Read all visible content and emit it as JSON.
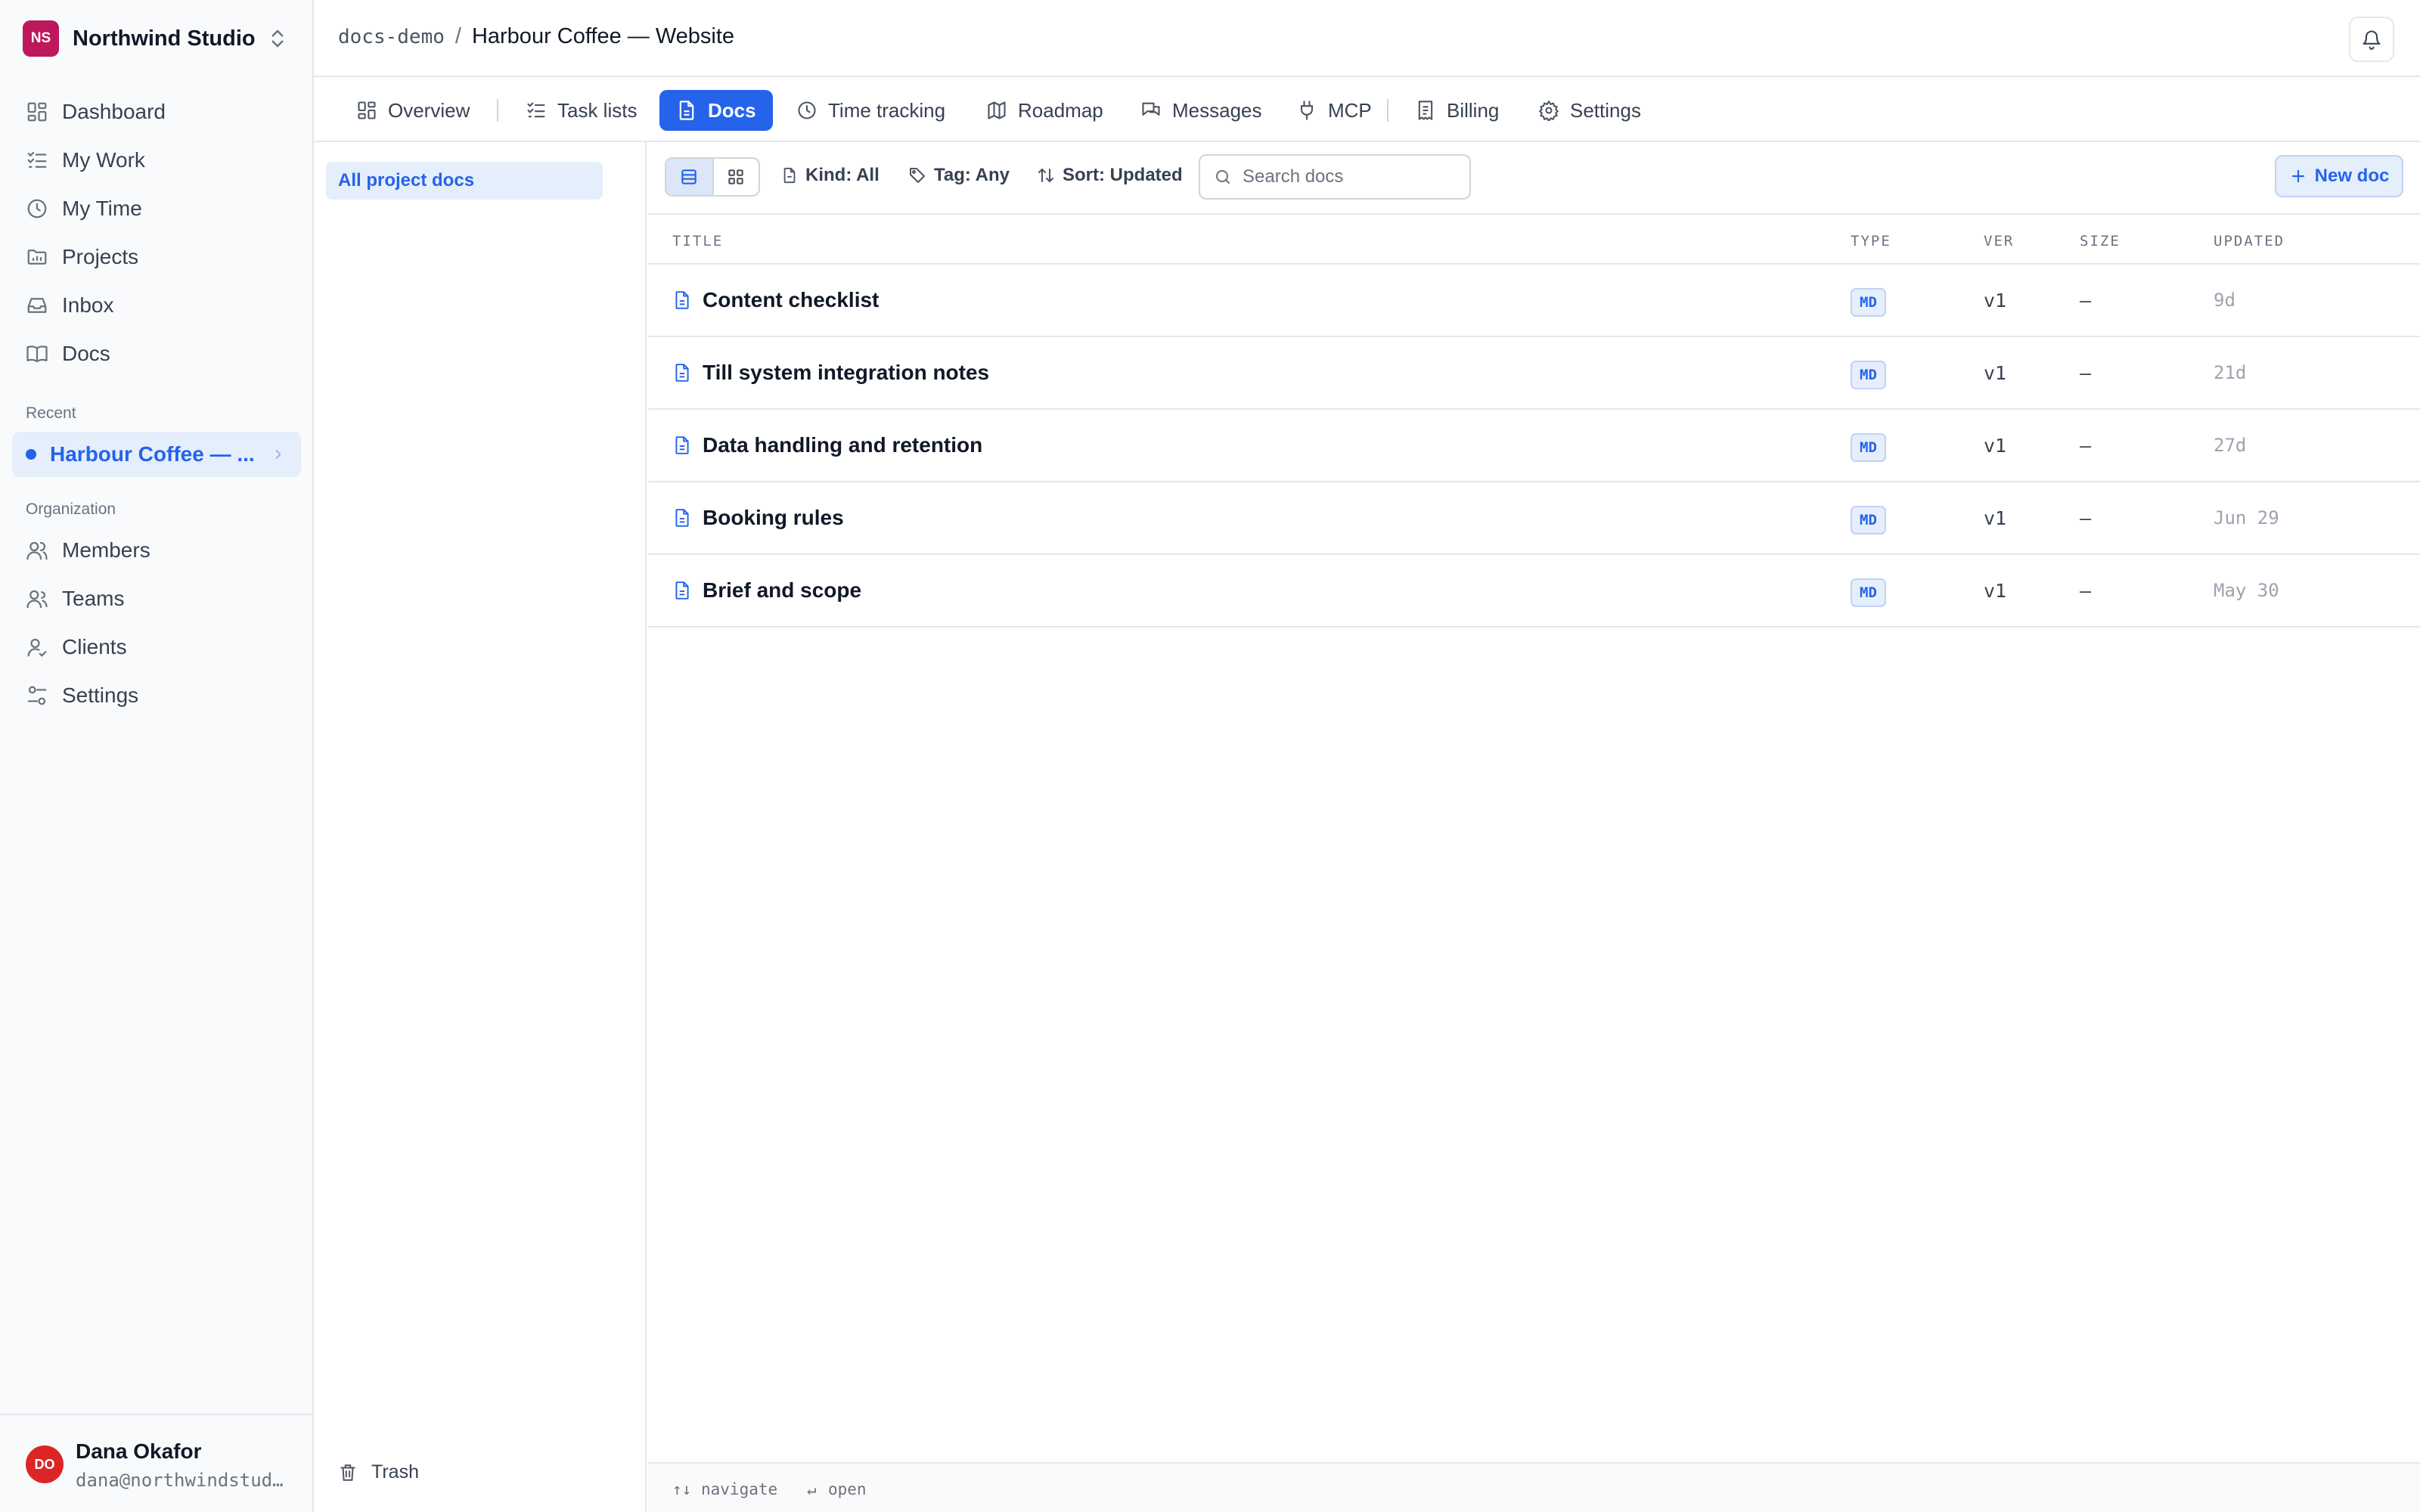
{
  "org": {
    "initials": "NS",
    "name": "Northwind Studio",
    "logo_color": "#be185d"
  },
  "sidebar": {
    "nav": [
      {
        "label": "Dashboard",
        "icon": "dashboard-icon"
      },
      {
        "label": "My Work",
        "icon": "list-check-icon"
      },
      {
        "label": "My Time",
        "icon": "clock-icon"
      },
      {
        "label": "Projects",
        "icon": "folder-icon"
      },
      {
        "label": "Inbox",
        "icon": "inbox-icon"
      },
      {
        "label": "Docs",
        "icon": "book-icon"
      }
    ],
    "recent_label": "Recent",
    "recent_item": "Harbour Coffee — ...",
    "organization_label": "Organization",
    "org_nav": [
      {
        "label": "Members",
        "icon": "users-icon"
      },
      {
        "label": "Teams",
        "icon": "team-icon"
      },
      {
        "label": "Clients",
        "icon": "user-check-icon"
      },
      {
        "label": "Settings",
        "icon": "sliders-icon"
      }
    ]
  },
  "user": {
    "initials": "DO",
    "name": "Dana Okafor",
    "email": "dana@northwindstud…",
    "avatar_color": "#dc2626"
  },
  "breadcrumb": {
    "workspace": "docs-demo",
    "separator": "/",
    "project": "Harbour Coffee — Website"
  },
  "tabs": [
    {
      "label": "Overview",
      "icon": "grid-icon"
    },
    {
      "label": "Task lists",
      "icon": "list-check-icon"
    },
    {
      "label": "Docs",
      "icon": "file-icon",
      "active": true
    },
    {
      "label": "Time tracking",
      "icon": "clock-icon"
    },
    {
      "label": "Roadmap",
      "icon": "map-icon"
    },
    {
      "label": "Messages",
      "icon": "messages-icon"
    },
    {
      "label": "MCP",
      "icon": "plug-icon"
    },
    {
      "label": "Billing",
      "icon": "receipt-icon"
    },
    {
      "label": "Settings",
      "icon": "gear-icon"
    }
  ],
  "docs_panel": {
    "all_docs": "All project docs",
    "trash": "Trash"
  },
  "toolbar": {
    "kind": "Kind: All",
    "tag": "Tag: Any",
    "sort": "Sort: Updated",
    "search_placeholder": "Search docs",
    "new_doc": "New doc"
  },
  "table": {
    "headers": {
      "title": "TITLE",
      "type": "TYPE",
      "ver": "VER",
      "size": "SIZE",
      "updated": "UPDATED"
    },
    "rows": [
      {
        "title": "Content checklist",
        "type": "MD",
        "ver": "v1",
        "size": "—",
        "updated": "9d"
      },
      {
        "title": "Till system integration notes",
        "type": "MD",
        "ver": "v1",
        "size": "—",
        "updated": "21d"
      },
      {
        "title": "Data handling and retention",
        "type": "MD",
        "ver": "v1",
        "size": "—",
        "updated": "27d"
      },
      {
        "title": "Booking rules",
        "type": "MD",
        "ver": "v1",
        "size": "—",
        "updated": "Jun 29"
      },
      {
        "title": "Brief and scope",
        "type": "MD",
        "ver": "v1",
        "size": "—",
        "updated": "May 30"
      }
    ]
  },
  "statusbar": {
    "navigate_key": "↑↓",
    "navigate": "navigate",
    "open_key": "↵",
    "open": "open"
  },
  "colors": {
    "accent": "#2563eb",
    "accent_soft": "#e5eefb",
    "border": "#e5e7eb"
  }
}
